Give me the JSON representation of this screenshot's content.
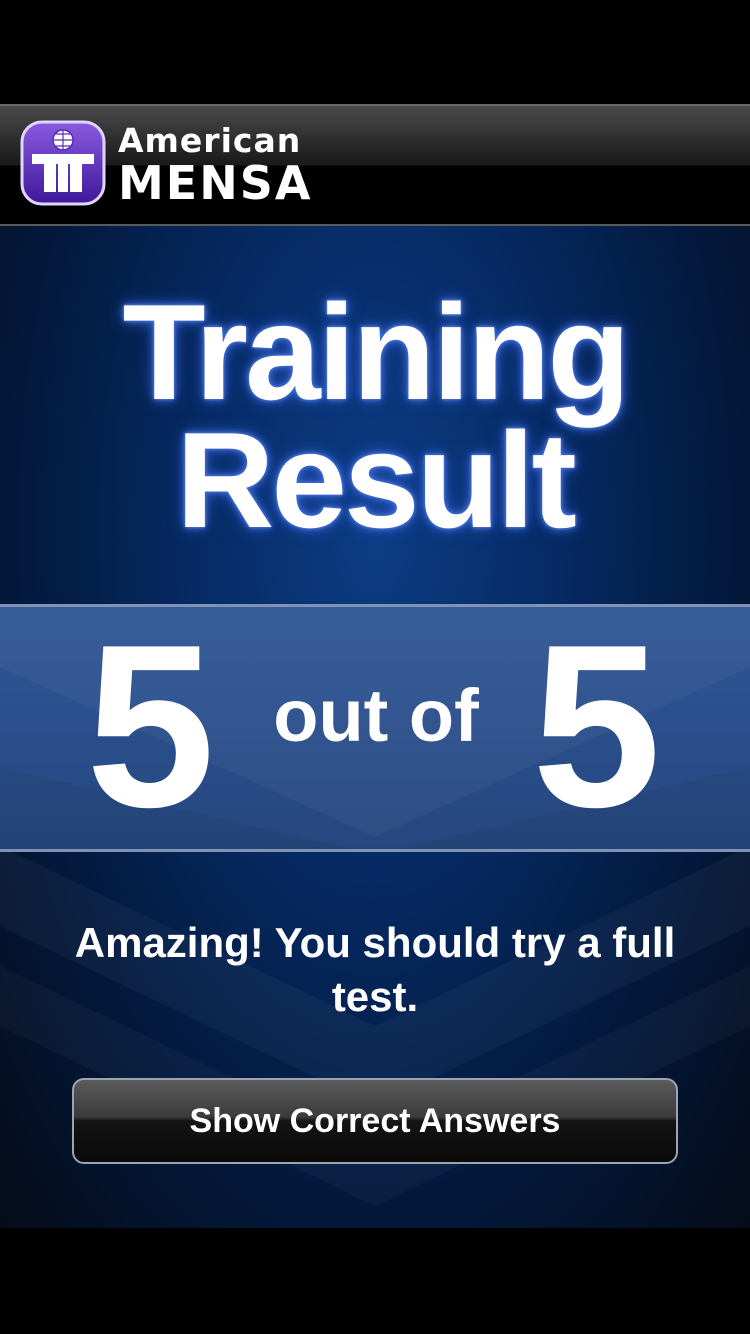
{
  "header": {
    "brand_line1": "American",
    "brand_line2": "MENSA",
    "logo_icon": "mensa-logo-icon"
  },
  "title": {
    "line1": "Training",
    "line2": "Result"
  },
  "score": {
    "correct": "5",
    "separator": "out of",
    "total": "5"
  },
  "message": "Amazing! You should try a full test.",
  "buttons": {
    "show_correct": "Show Correct Answers"
  },
  "colors": {
    "panel_blue": "#062a63",
    "band_blue": "#2a4f8c",
    "logo_purple": "#5a2db8"
  }
}
